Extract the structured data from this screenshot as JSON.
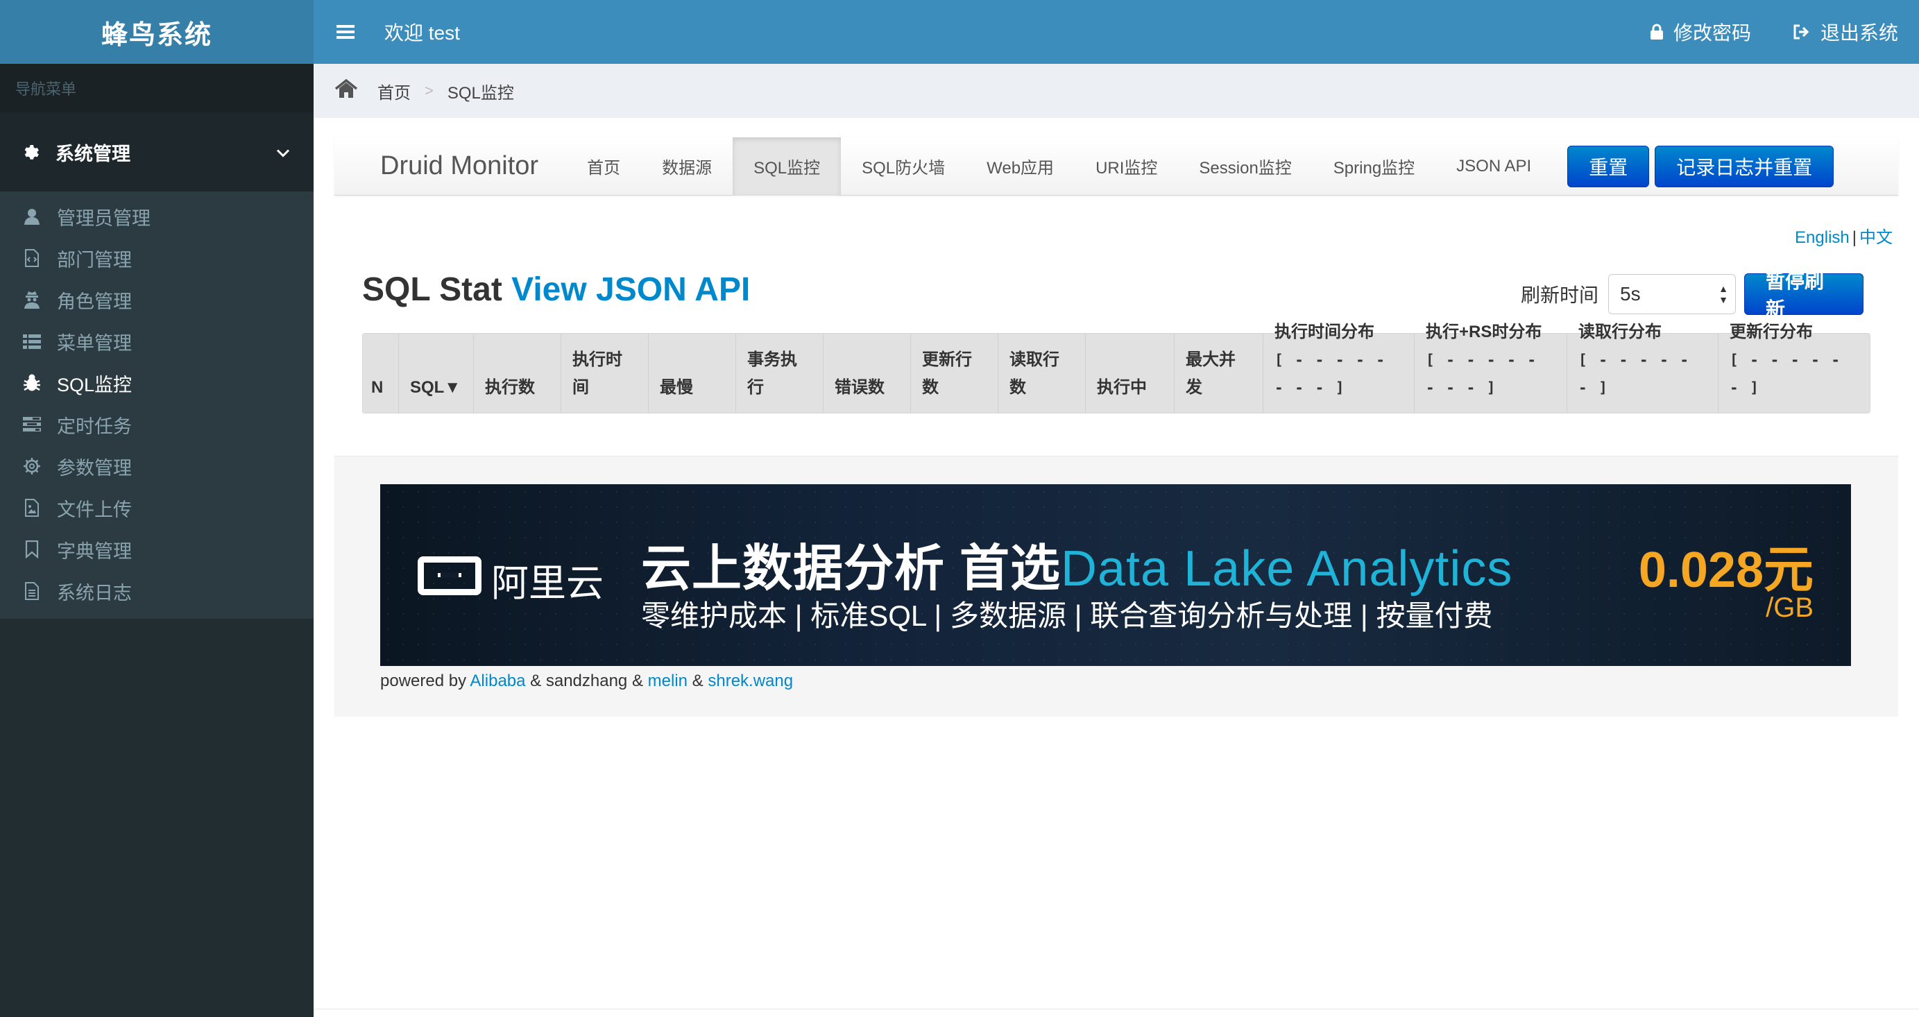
{
  "app": {
    "brand": "蜂鸟系统"
  },
  "topbar": {
    "welcome": "欢迎 test",
    "change_password": "修改密码",
    "logout": "退出系统"
  },
  "sidebar": {
    "header": "导航菜单",
    "group": "系统管理",
    "items": [
      {
        "label": "管理员管理",
        "icon": "user-icon"
      },
      {
        "label": "部门管理",
        "icon": "file-code-icon"
      },
      {
        "label": "角色管理",
        "icon": "user-secret-icon"
      },
      {
        "label": "菜单管理",
        "icon": "list-icon"
      },
      {
        "label": "SQL监控",
        "icon": "bug-icon",
        "active": true
      },
      {
        "label": "定时任务",
        "icon": "tasks-icon"
      },
      {
        "label": "参数管理",
        "icon": "gear-outline-icon"
      },
      {
        "label": "文件上传",
        "icon": "image-file-icon"
      },
      {
        "label": "字典管理",
        "icon": "bookmark-icon"
      },
      {
        "label": "系统日志",
        "icon": "file-text-icon"
      }
    ]
  },
  "breadcrumb": {
    "home": "首页",
    "sep": ">",
    "current": "SQL监控"
  },
  "druid": {
    "brand": "Druid Monitor",
    "nav": [
      "首页",
      "数据源",
      "SQL监控",
      "SQL防火墙",
      "Web应用",
      "URI监控",
      "Session监控",
      "Spring监控",
      "JSON API"
    ],
    "active_index": 2,
    "reset_button": "重置",
    "log_reset_button": "记录日志并重置",
    "lang_en": "English",
    "lang_sep": "|",
    "lang_zh": "中文",
    "title": "SQL Stat",
    "title_link": "View JSON API",
    "refresh_label": "刷新时间",
    "refresh_value": "5s",
    "pause_button": "暂停刷新",
    "columns": [
      {
        "l1": "N",
        "l2": ""
      },
      {
        "l1": "SQL▼",
        "l2": ""
      },
      {
        "l1": "执行数",
        "l2": ""
      },
      {
        "l1": "执行时",
        "l2": "间"
      },
      {
        "l1": "最慢",
        "l2": ""
      },
      {
        "l1": "事务执",
        "l2": "行"
      },
      {
        "l1": "错误数",
        "l2": ""
      },
      {
        "l1": "更新行",
        "l2": "数"
      },
      {
        "l1": "读取行",
        "l2": "数"
      },
      {
        "l1": "执行中",
        "l2": ""
      },
      {
        "l1": "最大并",
        "l2": "发"
      },
      {
        "l1": "执行时间分布",
        "l2": "[ - - - - - - - - ]"
      },
      {
        "l1": "执行+RS时分布",
        "l2": "[ - - - - - - - - ]"
      },
      {
        "l1": "读取行分布",
        "l2": "[ - - - - - - ]"
      },
      {
        "l1": "更新行分布",
        "l2": "[ - - - - - - ]"
      }
    ]
  },
  "banner": {
    "logo_text": "阿里云",
    "headline": "云上数据分析 首选",
    "headline_highlight": "Data Lake Analytics",
    "subline": "零维护成本 | 标准SQL | 多数据源 | 联合查询分析与处理 | 按量付费",
    "price": "0.028元",
    "unit": "/GB"
  },
  "powered": {
    "prefix": "powered by",
    "alibaba": "Alibaba",
    "amp1": "&",
    "sandzhang": "sandzhang",
    "amp2": "&",
    "melin": "melin",
    "amp3": "&",
    "shrek": "shrek.wang"
  },
  "colors": {
    "topbar": "#3c8dbc",
    "brand_bg": "#367fa9",
    "sidebar": "#222d32",
    "accent": "#0088cc"
  }
}
